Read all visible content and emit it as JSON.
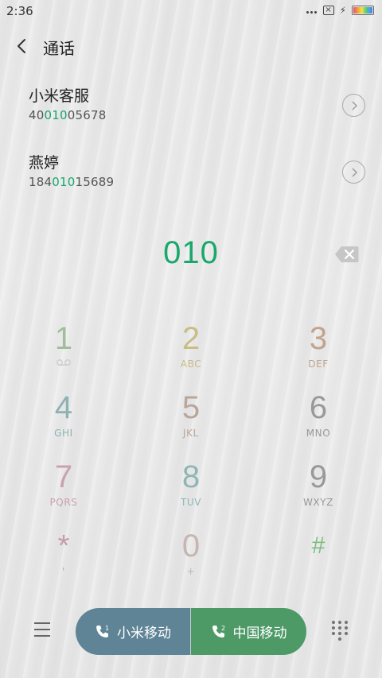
{
  "status": {
    "time": "2:36"
  },
  "header": {
    "title": "通话"
  },
  "contacts": [
    {
      "name": "小米客服",
      "number_pre": "40",
      "number_match": "010",
      "number_post": "05678"
    },
    {
      "name": "燕婷",
      "number_pre": "184",
      "number_match": "010",
      "number_post": "15689"
    }
  ],
  "dialed_number": "010",
  "keys": [
    {
      "digit": "1",
      "letters": "",
      "color": "#9fbf9a"
    },
    {
      "digit": "2",
      "letters": "ABC",
      "color": "#c7bd86"
    },
    {
      "digit": "3",
      "letters": "DEF",
      "color": "#c2a38e"
    },
    {
      "digit": "4",
      "letters": "GHI",
      "color": "#8fb1b4"
    },
    {
      "digit": "5",
      "letters": "JKL",
      "color": "#b9a69b"
    },
    {
      "digit": "6",
      "letters": "MNO",
      "color": "#999999"
    },
    {
      "digit": "7",
      "letters": "PQRS",
      "color": "#c9a2ae"
    },
    {
      "digit": "8",
      "letters": "TUV",
      "color": "#8fb6b6"
    },
    {
      "digit": "9",
      "letters": "WXYZ",
      "color": "#999999"
    },
    {
      "digit": "*",
      "letters": "",
      "color": "#c69da5"
    },
    {
      "digit": "0",
      "letters": "+",
      "color": "#c6b5b0"
    },
    {
      "digit": "#",
      "letters": "",
      "color": "#7fbd85"
    }
  ],
  "sim_buttons": {
    "sim1_label": "小米移动",
    "sim1_index": "1",
    "sim2_label": "中国移动",
    "sim2_index": "2"
  },
  "colors": {
    "accent": "#19a76a",
    "sim1_bg": "#5e8496",
    "sim2_bg": "#4d9a67"
  },
  "icons": [
    "back-icon",
    "chevron-right-icon",
    "backspace-icon",
    "voicemail-icon",
    "menu-icon",
    "phone-icon",
    "keypad-icon"
  ]
}
